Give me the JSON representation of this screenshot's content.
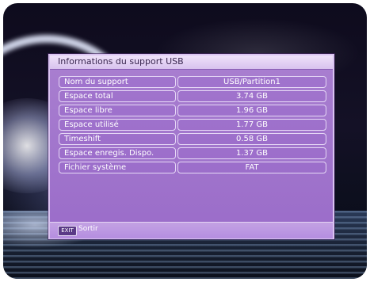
{
  "dialog": {
    "title": "Informations du support USB",
    "rows": [
      {
        "label": "Nom du support",
        "value": "USB/Partition1"
      },
      {
        "label": "Espace total",
        "value": "3.74  GB"
      },
      {
        "label": "Espace libre",
        "value": "1.96  GB"
      },
      {
        "label": "Espace utilisé",
        "value": "1.77  GB"
      },
      {
        "label": "Timeshift",
        "value": "0.58  GB"
      },
      {
        "label": "Espace enregis. Dispo.",
        "value": "1.37  GB"
      },
      {
        "label": "Fichier système",
        "value": "FAT"
      }
    ]
  },
  "footer": {
    "exit_key": "EXIT",
    "exit_label": "Sortir"
  },
  "colors": {
    "panel": "#9a6cc9",
    "title_bar": "#e6d6f5",
    "cell_border": "#e6d8f6"
  }
}
